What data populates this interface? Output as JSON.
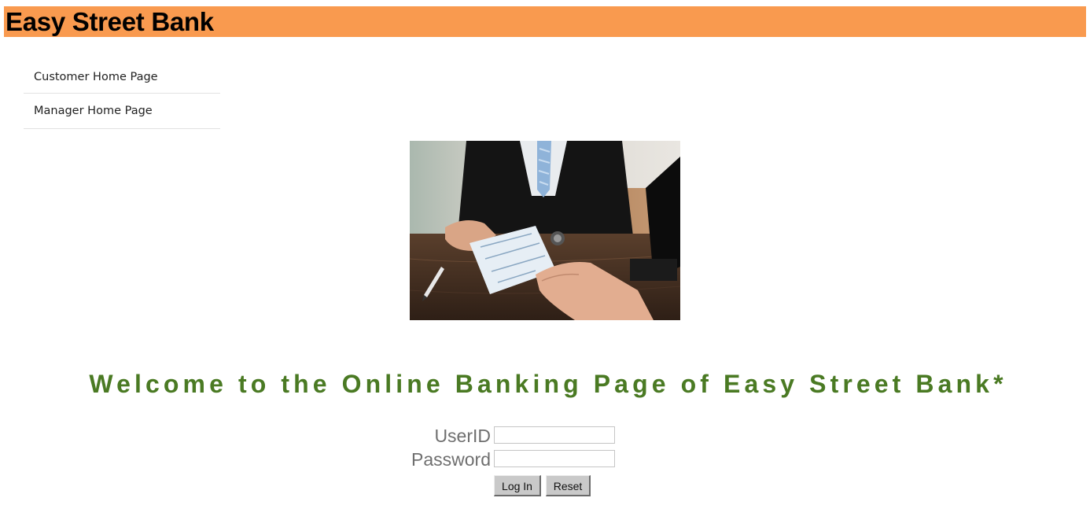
{
  "header": {
    "title": "Easy Street Bank",
    "background_color": "#f99a4f"
  },
  "sidebar": {
    "items": [
      {
        "label": "Customer Home Page"
      },
      {
        "label": "Manager Home Page"
      }
    ]
  },
  "main": {
    "hero_image": "photo-banker-handing-cheque",
    "welcome_text": "Welcome to the Online Banking Page of Easy Street Bank*",
    "welcome_color": "#4a7a23"
  },
  "login": {
    "userid_label": "UserID",
    "password_label": "Password",
    "userid_value": "",
    "password_value": "",
    "login_button": "Log In",
    "reset_button": "Reset"
  }
}
